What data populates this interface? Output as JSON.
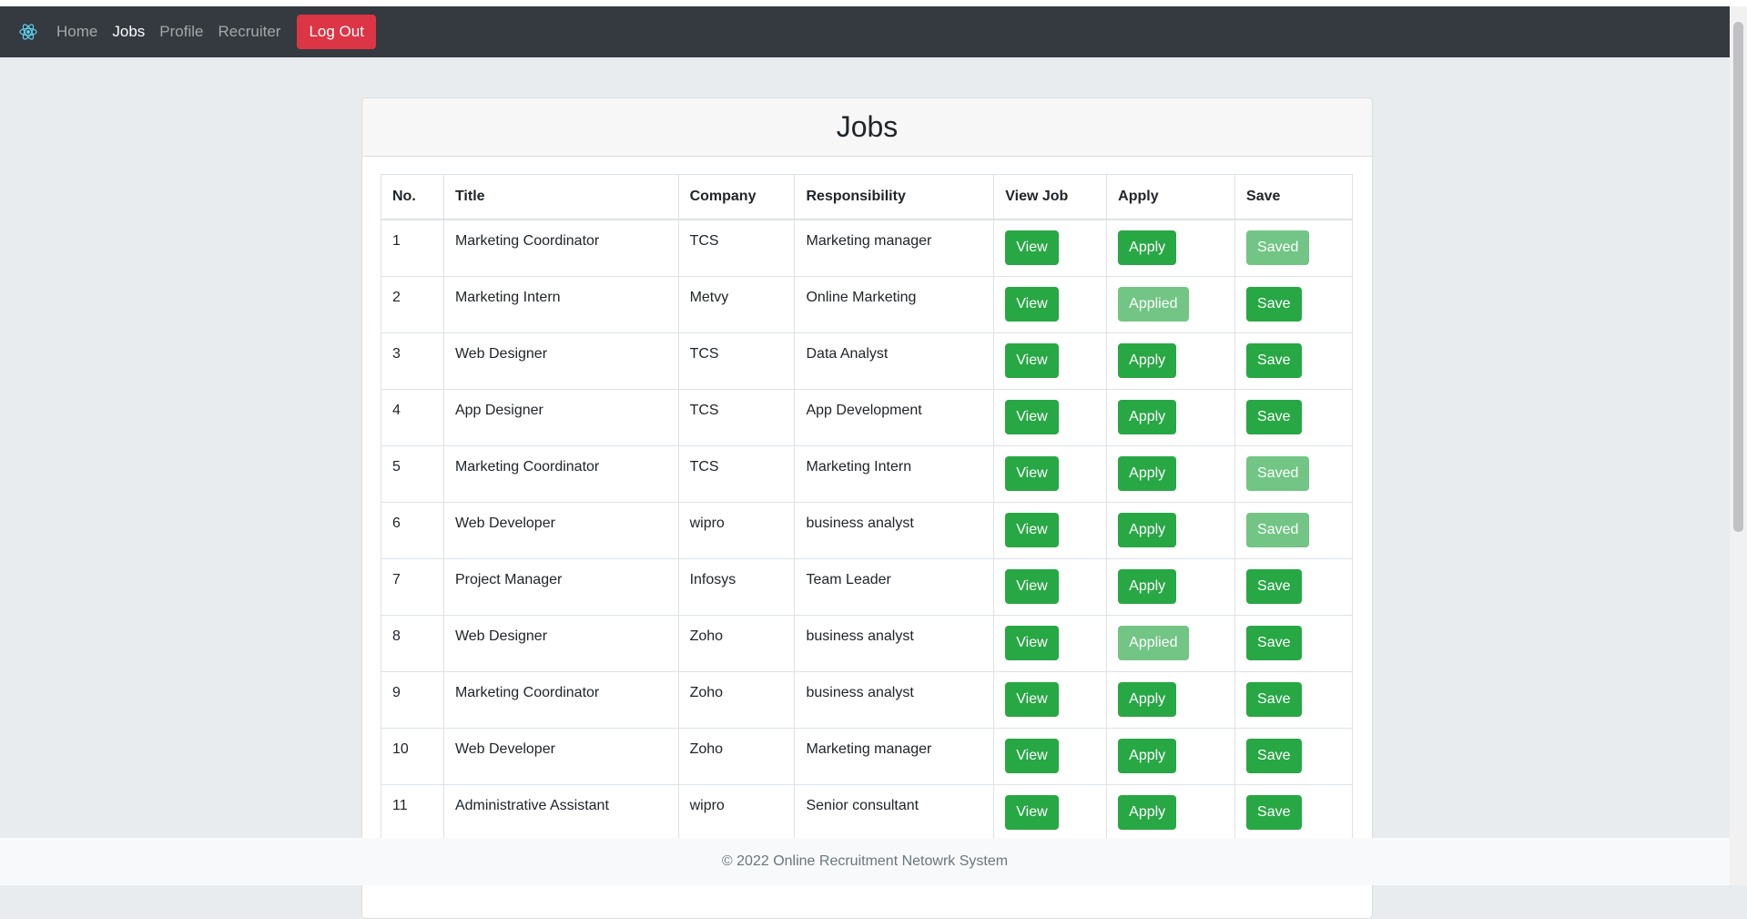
{
  "nav": {
    "brand_icon": "react-logo-icon",
    "links": [
      {
        "label": "Home",
        "active": false
      },
      {
        "label": "Jobs",
        "active": true
      },
      {
        "label": "Profile",
        "active": false
      },
      {
        "label": "Recruiter",
        "active": false
      }
    ],
    "logout_label": "Log Out"
  },
  "page": {
    "title": "Jobs"
  },
  "table": {
    "headers": [
      "No.",
      "Title",
      "Company",
      "Responsibility",
      "View Job",
      "Apply",
      "Save"
    ],
    "rows": [
      {
        "no": "1",
        "title": "Marketing Coordinator",
        "company": "TCS",
        "responsibility": "Marketing manager",
        "view": "View",
        "apply": "Apply",
        "save": "Saved"
      },
      {
        "no": "2",
        "title": "Marketing Intern",
        "company": "Metvy",
        "responsibility": "Online Marketing",
        "view": "View",
        "apply": "Applied",
        "save": "Save"
      },
      {
        "no": "3",
        "title": "Web Designer",
        "company": "TCS",
        "responsibility": "Data Analyst",
        "view": "View",
        "apply": "Apply",
        "save": "Save"
      },
      {
        "no": "4",
        "title": "App Designer",
        "company": "TCS",
        "responsibility": "App Development",
        "view": "View",
        "apply": "Apply",
        "save": "Save"
      },
      {
        "no": "5",
        "title": "Marketing Coordinator",
        "company": "TCS",
        "responsibility": "Marketing Intern",
        "view": "View",
        "apply": "Apply",
        "save": "Saved"
      },
      {
        "no": "6",
        "title": "Web Developer",
        "company": "wipro",
        "responsibility": "business analyst",
        "view": "View",
        "apply": "Apply",
        "save": "Saved"
      },
      {
        "no": "7",
        "title": "Project Manager",
        "company": "Infosys",
        "responsibility": "Team Leader",
        "view": "View",
        "apply": "Apply",
        "save": "Save"
      },
      {
        "no": "8",
        "title": "Web Designer",
        "company": "Zoho",
        "responsibility": "business analyst",
        "view": "View",
        "apply": "Applied",
        "save": "Save"
      },
      {
        "no": "9",
        "title": "Marketing Coordinator",
        "company": "Zoho",
        "responsibility": "business analyst",
        "view": "View",
        "apply": "Apply",
        "save": "Save"
      },
      {
        "no": "10",
        "title": "Web Developer",
        "company": "Zoho",
        "responsibility": "Marketing manager",
        "view": "View",
        "apply": "Apply",
        "save": "Save"
      },
      {
        "no": "11",
        "title": "Administrative Assistant",
        "company": "wipro",
        "responsibility": "Senior consultant",
        "view": "View",
        "apply": "Apply",
        "save": "Save"
      }
    ]
  },
  "footer": {
    "text": "© 2022 Online Recruitment Netowrk System"
  },
  "colors": {
    "navbar": "#343a40",
    "danger": "#dc3545",
    "success": "#28a745",
    "page_bg": "#e9ecef"
  }
}
